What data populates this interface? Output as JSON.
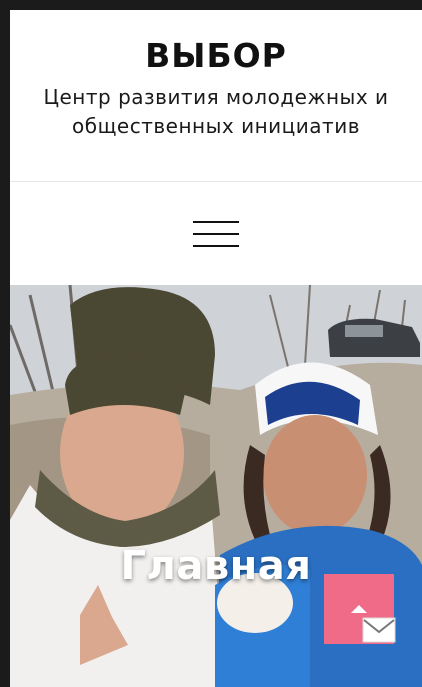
{
  "site": {
    "title": "ВЫБОР",
    "tagline": "Центр развития молодежных и общественных инициатив"
  },
  "nav": {
    "menu_icon": "hamburger-menu-icon"
  },
  "hero": {
    "title": "Главная",
    "image": "photo of two young people outdoors in winter"
  },
  "actions": {
    "scroll_top_icon": "chevron-up-icon",
    "mail_icon": "envelope-icon"
  },
  "colors": {
    "accent": "#f06b87",
    "page_bg": "#ffffff",
    "frame_bg": "#1b1b1b"
  }
}
